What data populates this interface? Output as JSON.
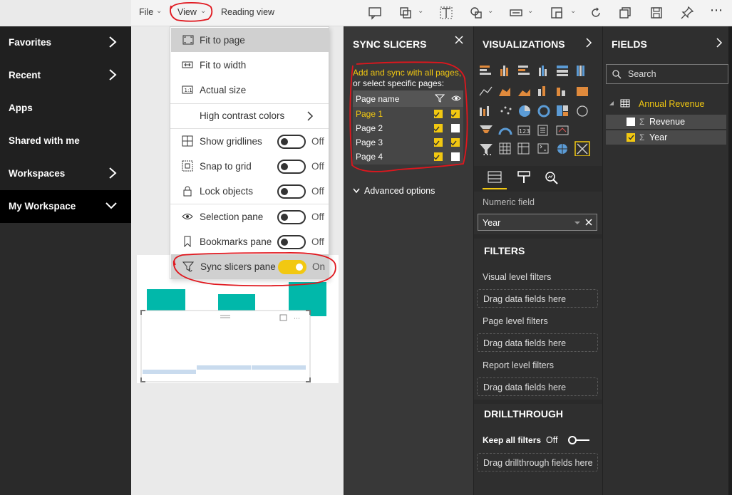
{
  "toolbar": {
    "file_label": "File",
    "view_label": "View",
    "reading_view_label": "Reading view"
  },
  "nav": {
    "items": [
      {
        "label": "Favorites"
      },
      {
        "label": "Recent"
      },
      {
        "label": "Apps"
      },
      {
        "label": "Shared with me"
      },
      {
        "label": "Workspaces"
      },
      {
        "label": "My Workspace"
      }
    ]
  },
  "view_menu": {
    "fit_to_page": "Fit to page",
    "fit_to_width": "Fit to width",
    "actual_size": "Actual size",
    "high_contrast": "High contrast colors",
    "show_gridlines": {
      "label": "Show gridlines",
      "state": "Off"
    },
    "snap_to_grid": {
      "label": "Snap to grid",
      "state": "Off"
    },
    "lock_objects": {
      "label": "Lock objects",
      "state": "Off"
    },
    "selection_pane": {
      "label": "Selection pane",
      "state": "Off"
    },
    "bookmarks_pane": {
      "label": "Bookmarks pane",
      "state": "Off"
    },
    "sync_slicers_pane": {
      "label": "Sync slicers pane",
      "state": "On"
    }
  },
  "sync_slicers": {
    "title": "SYNC SLICERS",
    "intro_line1": "Add and sync with all pages,",
    "intro_line2": "or select specific pages:",
    "col_page_name": "Page name",
    "pages": [
      {
        "name": "Page 1",
        "sync": true,
        "visible": true
      },
      {
        "name": "Page 2",
        "sync": true,
        "visible": false
      },
      {
        "name": "Page 3",
        "sync": true,
        "visible": true
      },
      {
        "name": "Page 4",
        "sync": true,
        "visible": false
      }
    ],
    "advanced_options": "Advanced options"
  },
  "visualizations": {
    "title": "VISUALIZATIONS",
    "numeric_field_label": "Numeric field",
    "numeric_field_value": "Year",
    "filters_title": "FILTERS",
    "visual_level": "Visual level filters",
    "page_level": "Page level filters",
    "report_level": "Report level filters",
    "drag_here": "Drag data fields here",
    "drillthrough_title": "DRILLTHROUGH",
    "keep_all_filters": "Keep all filters",
    "keep_all_state": "Off",
    "drag_drillthrough": "Drag drillthrough fields here",
    "more": "..."
  },
  "fields": {
    "title": "FIELDS",
    "search_placeholder": "Search",
    "table_name": "Annual Revenue",
    "items": [
      {
        "label": "Revenue",
        "checked": false
      },
      {
        "label": "Year",
        "checked": true
      }
    ]
  },
  "colors": {
    "accent_yellow": "#f2c811",
    "teal": "#01b8aa",
    "annotation_red": "#e0161d"
  }
}
